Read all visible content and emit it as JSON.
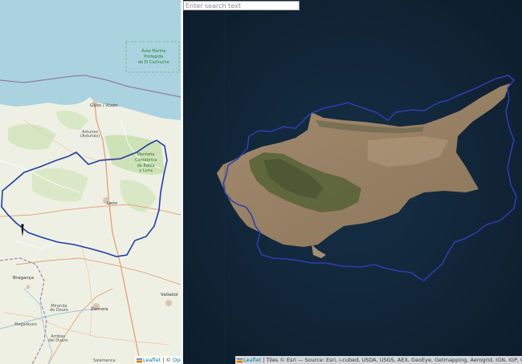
{
  "left_map": {
    "labels": {
      "marine_area": "Área Marina\nProtegida\nde El Cachucho",
      "gijon": "Gijón / Xixón",
      "asturias": "Asturies\n(Asturias)",
      "cantabrica": "Montaña\nCantábrica\nde Babia\ny Luna",
      "leon": "León",
      "braganca": "Bragança",
      "zamora": "Zamora",
      "miranda": "Miranda\ndo Douro",
      "mogadouro": "Mogadouro",
      "arribes": "Arribes\ndel Duero",
      "valladolid": "Valladol",
      "salamanca": "Salamanca"
    },
    "attribution": {
      "leaflet": "Leaflet",
      "separator": " | © ",
      "osm": "OpenS"
    }
  },
  "search": {
    "placeholder": "Enter search text",
    "value": ""
  },
  "right_map": {
    "attribution": {
      "leaflet": "Leaflet",
      "text": " | Tiles © Esri — Source: Esri, i-cubed, USDA, USGS, AEX, GeoEye, Getmapping, Aerogrid, IGN, IGP, UPR-EGP, and the G"
    }
  },
  "colors": {
    "sea_light": "#aad3df",
    "land_light": "#eef0e4",
    "boundary": "#1f3fa8",
    "sea_dark": "#0f2133",
    "island": "#a2866a",
    "mountains": "#5a6438",
    "link": "#0078a8"
  },
  "icons": [
    "leaflet-flag-icon",
    "location-marker-icon"
  ]
}
